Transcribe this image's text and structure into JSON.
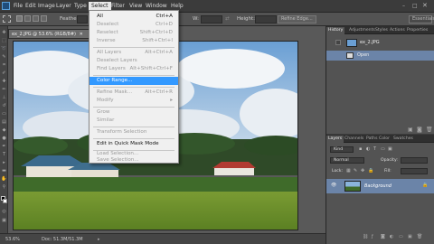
{
  "menubar": {
    "items": [
      "File",
      "Edit",
      "Image",
      "Layer",
      "Type",
      "Select",
      "Filter",
      "View",
      "Window",
      "Help"
    ],
    "essentials": "Essentials"
  },
  "options": {
    "feather_label": "Feather:",
    "width_label": "W:",
    "height_label": "Height:",
    "refine_edge": "Refine Edge..."
  },
  "document": {
    "tab_title": "ex_2.JPG @ 53.6% (RGB/8#)"
  },
  "status": {
    "zoom": "53.6%",
    "doc": "Doc: 51.3M/51.3M"
  },
  "select_menu": {
    "items": [
      {
        "label": "All",
        "shortcut": "Ctrl+A",
        "disabled": false
      },
      {
        "label": "Deselect",
        "shortcut": "Ctrl+D",
        "disabled": true
      },
      {
        "label": "Reselect",
        "shortcut": "Shift+Ctrl+D",
        "disabled": true
      },
      {
        "label": "Inverse",
        "shortcut": "Shift+Ctrl+I",
        "disabled": true
      },
      {
        "label": "All Layers",
        "shortcut": "Alt+Ctrl+A",
        "disabled": true
      },
      {
        "label": "Deselect Layers",
        "shortcut": "",
        "disabled": true
      },
      {
        "label": "Find Layers",
        "shortcut": "Alt+Shift+Ctrl+F",
        "disabled": true
      },
      {
        "label": "Color Range...",
        "shortcut": "",
        "disabled": false,
        "highlight": true
      },
      {
        "label": "Refine Mask...",
        "shortcut": "Alt+Ctrl+R",
        "disabled": true
      },
      {
        "label": "Modify",
        "shortcut": "▸",
        "disabled": true
      },
      {
        "label": "Grow",
        "shortcut": "",
        "disabled": true
      },
      {
        "label": "Similar",
        "shortcut": "",
        "disabled": true
      },
      {
        "label": "Transform Selection",
        "shortcut": "",
        "disabled": true
      },
      {
        "label": "Edit in Quick Mask Mode",
        "shortcut": "",
        "disabled": false
      },
      {
        "label": "Load Selection...",
        "shortcut": "",
        "disabled": true
      },
      {
        "label": "Save Selection...",
        "shortcut": "",
        "disabled": true
      }
    ]
  },
  "history_panel": {
    "tabs": [
      "History",
      "Adjustments",
      "Styles",
      "Actions",
      "Properties"
    ],
    "snapshot": "ex_2.JPG",
    "state": "Open"
  },
  "layers_panel": {
    "tabs": [
      "Layers",
      "Channels",
      "Paths",
      "Color",
      "Swatches"
    ],
    "filter": "Kind",
    "blend_mode": "Normal",
    "opacity_label": "Opacity:",
    "lock_label": "Lock:",
    "fill_label": "Fill:",
    "layer_name": "Background"
  },
  "colors": {
    "highlight": "#3399ff",
    "selected_row": "#6b84a8"
  }
}
